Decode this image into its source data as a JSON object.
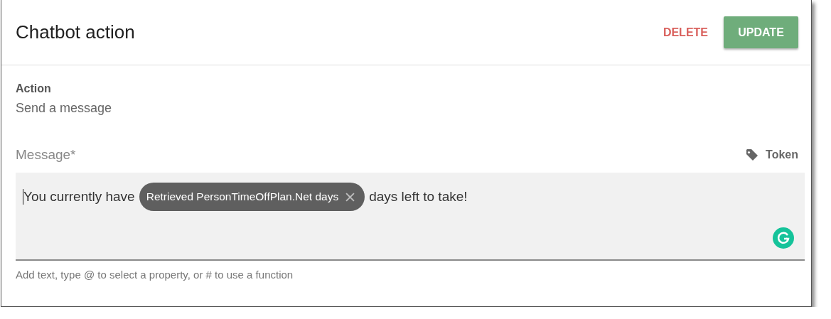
{
  "dialog": {
    "title": "Chatbot action",
    "buttons": [
      {
        "label": "DELETE",
        "kind": "text"
      },
      {
        "label": "UPDATE",
        "kind": "raised"
      }
    ]
  },
  "action": {
    "label": "Action",
    "value": "Send a message"
  },
  "message": {
    "label": "Message*",
    "token_button": "Token",
    "content": [
      {
        "kind": "text",
        "text": "You currently have"
      },
      {
        "kind": "chip",
        "text": "Retrieved PersonTimeOffPlan.Net days"
      },
      {
        "kind": "text",
        "text": "days left to take!"
      }
    ],
    "helper": "Add text, type @ to select a property, or # to use a function"
  }
}
